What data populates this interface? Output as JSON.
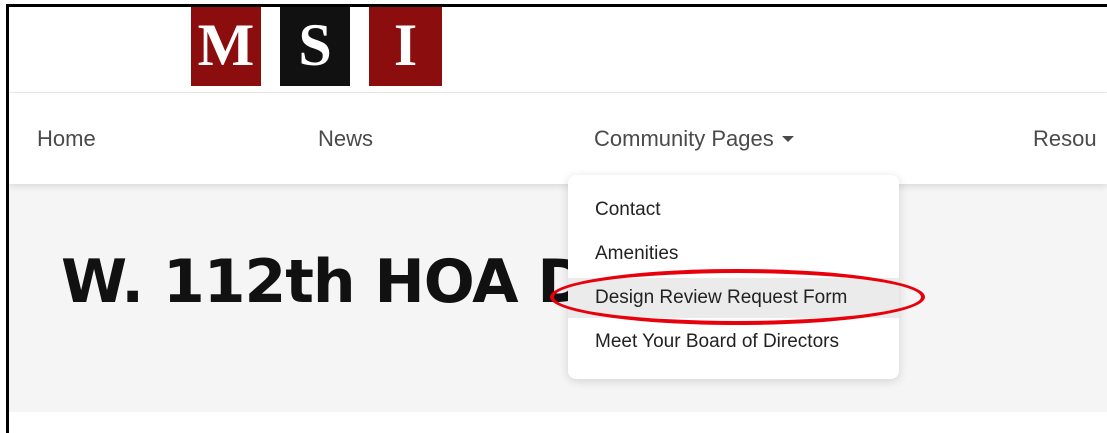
{
  "logo": {
    "letters": [
      "M",
      "S",
      "I"
    ]
  },
  "nav": {
    "home": "Home",
    "news": "News",
    "community": "Community Pages",
    "resources": "Resou"
  },
  "dropdown": {
    "items": [
      "Contact",
      "Amenities",
      "Design Review Request Form",
      "Meet Your Board of Directors"
    ],
    "highlighted": "Design Review Request Form"
  },
  "page": {
    "title": "W. 112th HOA Der"
  },
  "colors": {
    "logo_red": "#8b0d0d",
    "logo_black": "#111111",
    "annotation_red": "#e8000b",
    "nav_text": "#4a4a4a"
  }
}
